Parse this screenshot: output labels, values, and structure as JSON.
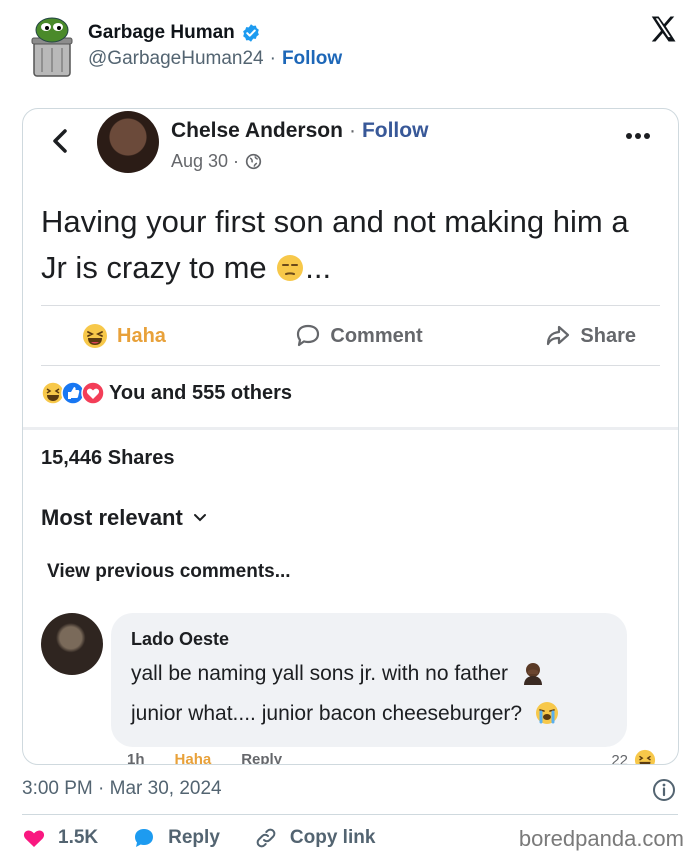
{
  "tweet": {
    "author_name": "Garbage Human",
    "handle": "@GarbageHuman24",
    "separator": "·",
    "follow_label": "Follow",
    "timestamp": "3:00 PM · Mar 30, 2024",
    "actions": {
      "like_count": "1.5K",
      "reply_label": "Reply",
      "copy_link_label": "Copy link"
    },
    "colors": {
      "like": "#f91880",
      "reply": "#1d9bf0",
      "verified": "#1d9bf0"
    }
  },
  "fb_post": {
    "author": "Chelse Anderson",
    "separator": "·",
    "follow_label": "Follow",
    "date": "Aug 30 ·",
    "text": "Having your first son and not making him a Jr is crazy to me",
    "text_suffix": "...",
    "actions": {
      "haha_label": "Haha",
      "comment_label": "Comment",
      "share_label": "Share"
    },
    "reactions_text": "You and 555 others",
    "shares_text": "15,446 Shares",
    "sort_label": "Most relevant",
    "view_previous": "View previous comments..."
  },
  "comment": {
    "author": "Lado Oeste",
    "line1": "yall be naming yall sons jr. with no father",
    "line2": "junior what.... junior bacon cheeseburger?",
    "time": "1h",
    "haha_label": "Haha",
    "reply_label": "Reply",
    "reaction_count": "22"
  },
  "watermark": "boredpanda.com"
}
